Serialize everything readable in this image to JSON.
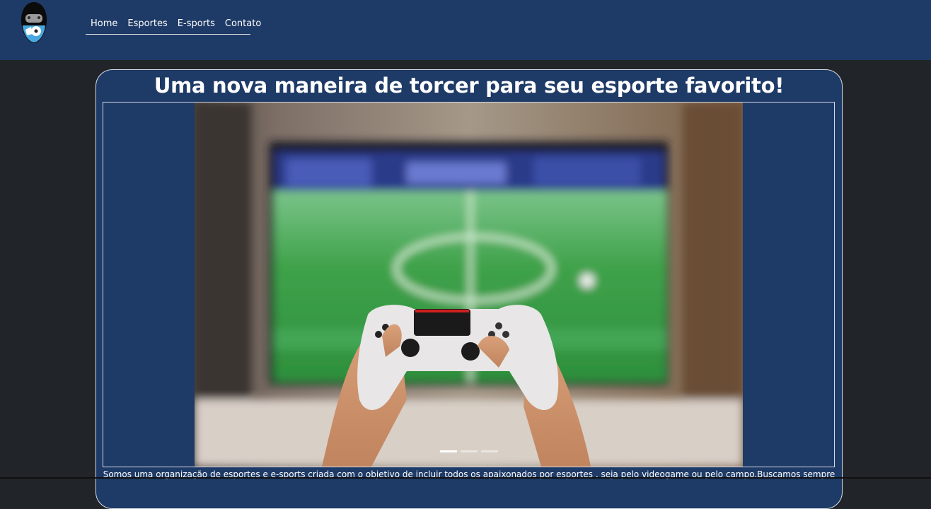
{
  "navbar": {
    "logo_icon": "gamepad-ball-shield-logo",
    "links": [
      {
        "label": "Home"
      },
      {
        "label": "Esportes"
      },
      {
        "label": "E-sports"
      },
      {
        "label": "Contato"
      }
    ],
    "background": "#1e3a66"
  },
  "hero": {
    "title": "Uma nova maneira de torcer para seu esporte favorito!"
  },
  "carousel": {
    "image_description_icon": "hands-holding-game-controller-photo",
    "indicator_count": 3,
    "active_index": 0
  },
  "about": {
    "text": "Somos uma organização de esportes e e-sports criada com o objetivo de incluir todos os apaixonados por esportes , seja pelo videogame ou pelo campo.Buscamos sempre"
  },
  "colors": {
    "page_bg": "#212529",
    "card_bg": "#1e3a66",
    "text": "#ffffff"
  }
}
